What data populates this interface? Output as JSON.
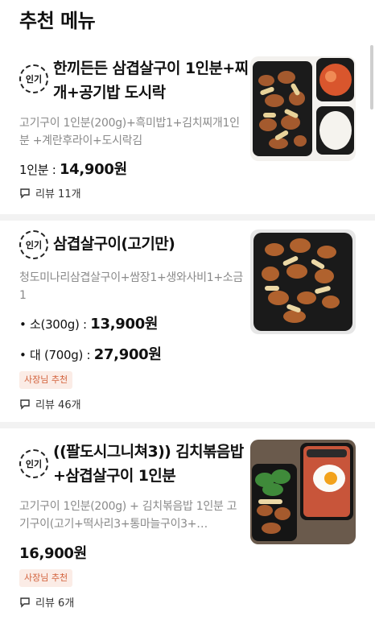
{
  "section": {
    "title": "추천 메뉴"
  },
  "badge_label": "인기",
  "items": [
    {
      "name": "한끼든든 삼겹살구이 1인분+찌개+공기밥 도시락",
      "description": "고기구이 1인분(200g)+흑미밥1+김치찌개1인분 +계란후라이+도시락김",
      "prices": [
        {
          "label": "1인분 :",
          "price": "14,900원"
        }
      ],
      "review": "리뷰 11개"
    },
    {
      "name": "삼겹살구이(고기만)",
      "description": "청도미나리삼겹살구이+쌈장1+생와사비1+소금1",
      "prices": [
        {
          "label": "• 소(300g) :",
          "price": "13,900원"
        },
        {
          "label": "• 대 (700g) :",
          "price": "27,900원"
        }
      ],
      "owner_tag": "사장님 추천",
      "review": "리뷰 46개"
    },
    {
      "name": "((팔도시그니쳐3)) 김치볶음밥+삼겹살구이 1인분",
      "description": "고기구이 1인분(200g) + 김치볶음밥 1인분 고기구이(고기+떡사리3+통마늘구이3+…",
      "prices": [
        {
          "label": "",
          "price": "16,900원"
        }
      ],
      "owner_tag": "사장님 추천",
      "review": "리뷰 6개"
    }
  ],
  "colors": {
    "owner_tag_bg": "#fbece6",
    "owner_tag_text": "#d2603a",
    "desc": "#8a8a8a"
  }
}
